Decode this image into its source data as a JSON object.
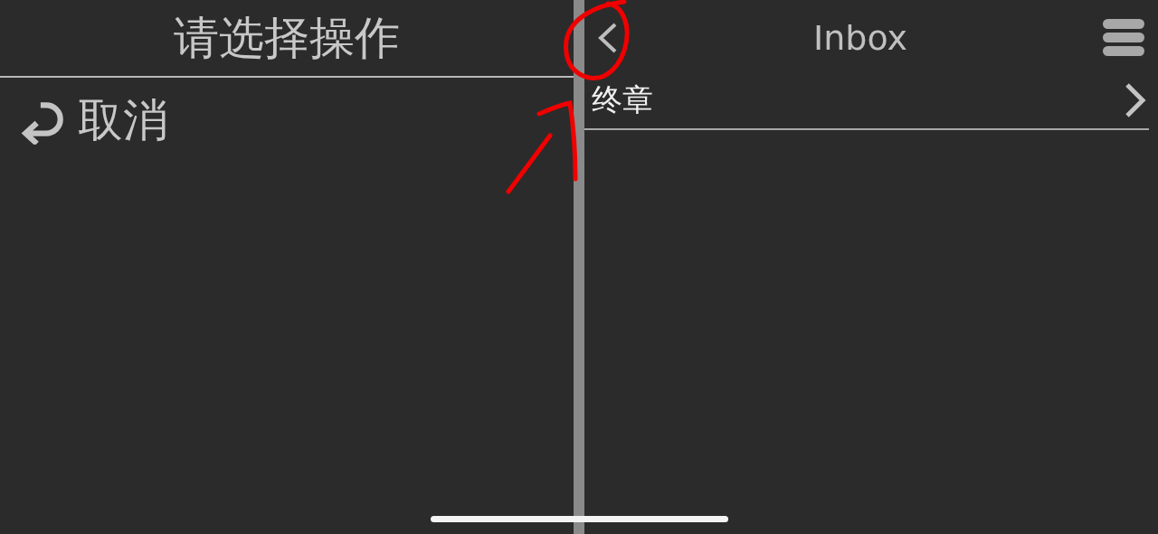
{
  "action_panel": {
    "title": "请选择操作",
    "actions": [
      {
        "label": "取消"
      }
    ]
  },
  "mailbox_panel": {
    "title": "Inbox",
    "rows": [
      {
        "label": "终章"
      }
    ]
  }
}
